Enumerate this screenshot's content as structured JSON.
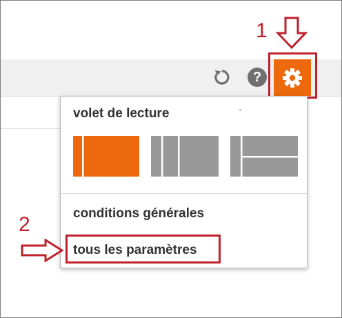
{
  "annotations": {
    "step1": "1",
    "step2": "2",
    "color": "#c0202a"
  },
  "toolbar": {
    "refresh_icon": "refresh-icon",
    "help_label": "?",
    "settings_icon": "gear-icon",
    "accent_color": "#ec6a0d"
  },
  "dropdown": {
    "reading_pane_title": "volet de lecture",
    "layout_options": [
      {
        "name": "single-pane",
        "selected": true
      },
      {
        "name": "three-columns",
        "selected": false
      },
      {
        "name": "split-horizontal",
        "selected": false
      }
    ],
    "links": [
      "conditions générales",
      "tous les paramètres"
    ]
  }
}
